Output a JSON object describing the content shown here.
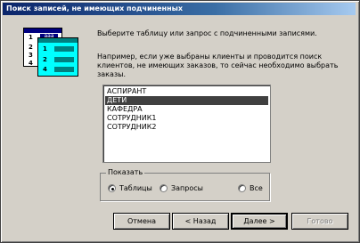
{
  "window": {
    "title": "Поиск записей, не имеющих подчиненных"
  },
  "illustration": {
    "back_numbers": [
      "1",
      "2",
      "3",
      "4"
    ],
    "front_numbers": [
      "1",
      "2",
      "4"
    ],
    "field_text": "ааа",
    "colors": {
      "front": "#00ffff",
      "back_header": "#000080",
      "front_header": "#008080"
    }
  },
  "description": {
    "line1": "Выберите таблицу или запрос с подчиненными записями.",
    "line2": "Например, если уже выбраны клиенты и проводится поиск клиентов, не имеющих заказов, то сейчас необходимо выбрать заказы."
  },
  "listbox": {
    "items": [
      "АСПИРАНТ",
      "ДЕТИ",
      "КАФЕДРА",
      "СОТРУДНИК1",
      "СОТРУДНИК2"
    ],
    "selected_index": 1
  },
  "show_group": {
    "label": "Показать",
    "options": [
      {
        "label": "Таблицы",
        "checked": true
      },
      {
        "label": "Запросы",
        "checked": false
      },
      {
        "label": "Все",
        "checked": false
      }
    ]
  },
  "buttons": {
    "cancel": "Отмена",
    "back": "< Назад",
    "next": "Далее >",
    "finish": "Готово"
  }
}
